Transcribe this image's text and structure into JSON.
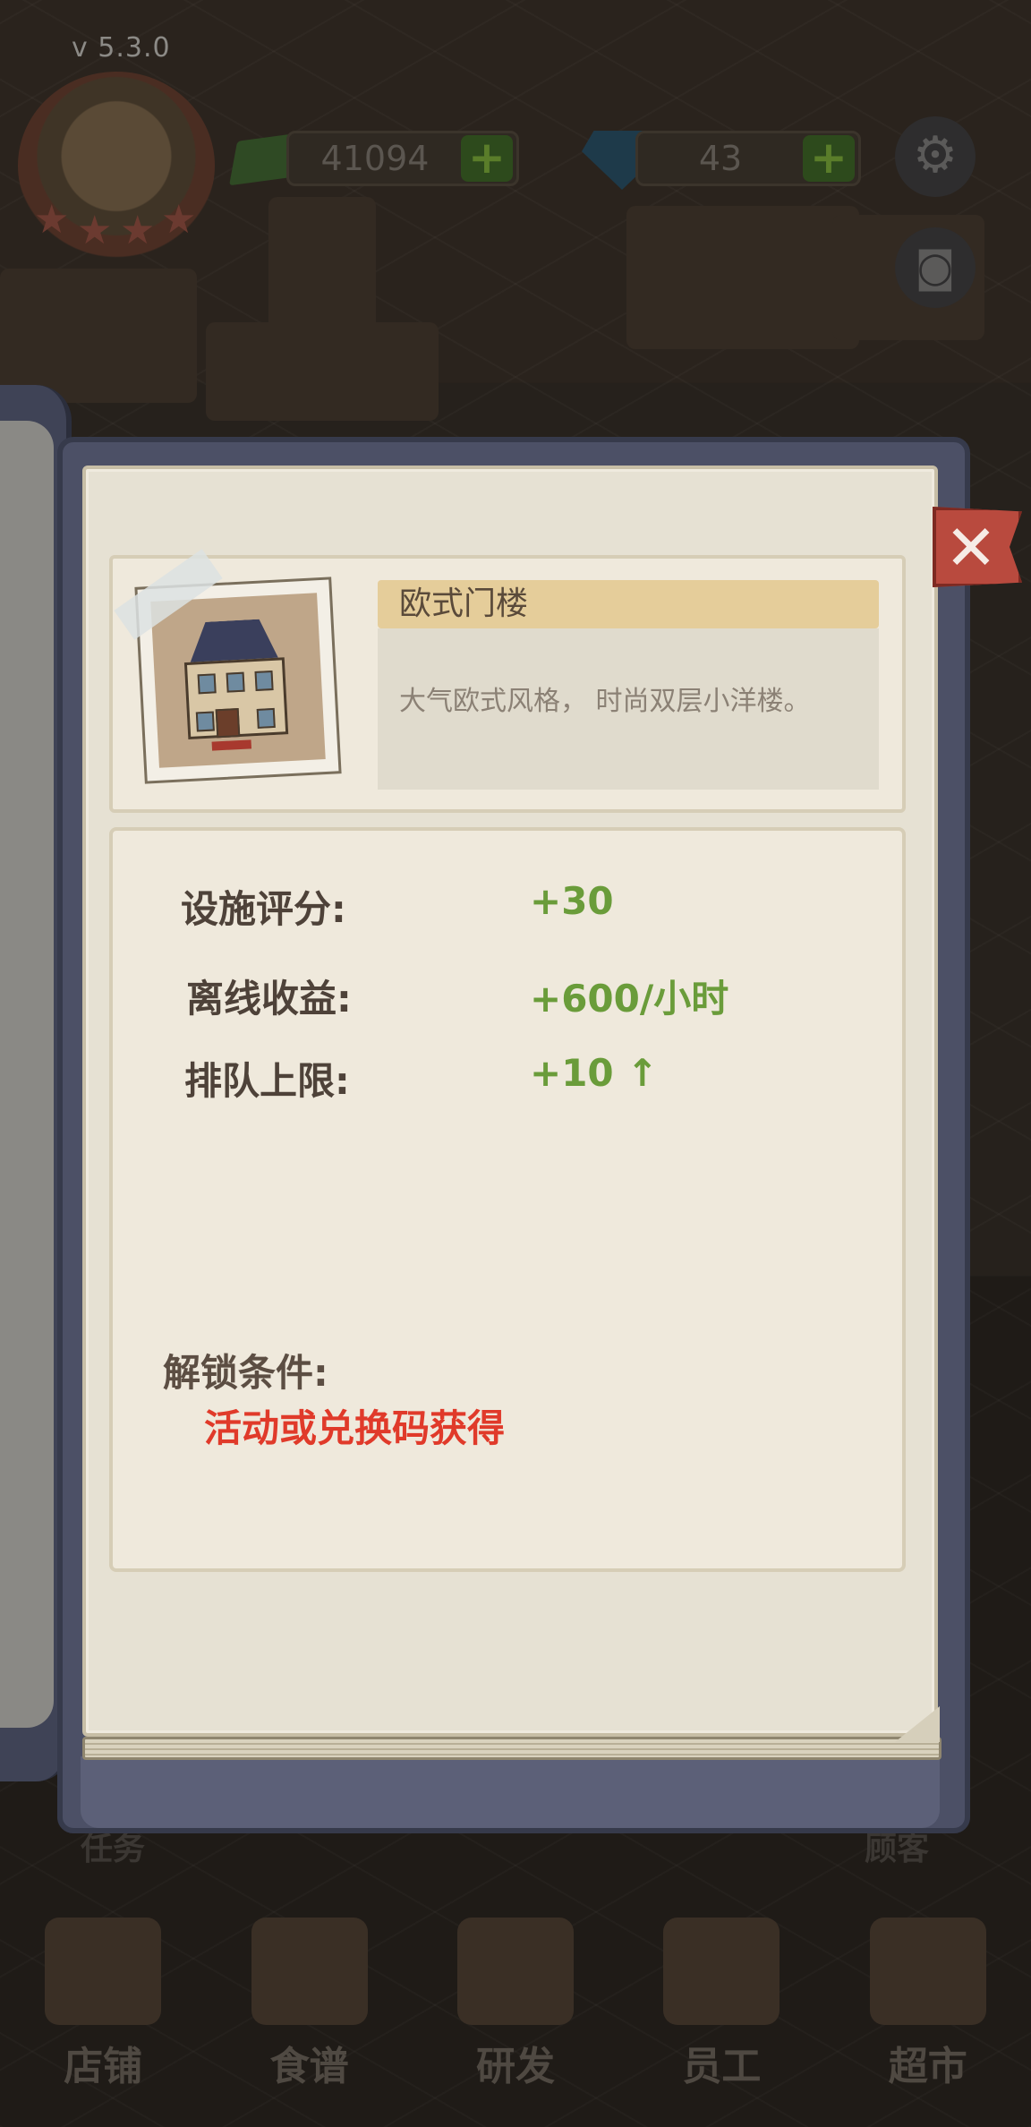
{
  "version": "v  5.3.0",
  "currency": {
    "cash": "41094",
    "gems": "43",
    "plus": "+"
  },
  "item": {
    "name": "欧式门楼",
    "description": "大气欧式风格， 时尚双层小洋楼。"
  },
  "stats": [
    {
      "label": "设施评分:",
      "value": "+30"
    },
    {
      "label": "离线收益:",
      "value": "+600/小时"
    },
    {
      "label": "排队上限:",
      "value": "+10 ↑"
    }
  ],
  "unlock": {
    "label": "解锁条件:",
    "value": "活动或兑换码获得"
  },
  "bottom_nav": [
    "店铺",
    "食谱",
    "研发",
    "员工",
    "超市"
  ],
  "side_labels": {
    "left": "任务",
    "right": "顾客"
  },
  "icons": {
    "close": "close-icon",
    "settings": "gear-icon",
    "camera": "camera-icon"
  },
  "colors": {
    "stat_value": "#6a9c3a",
    "unlock_value": "#e03a2a",
    "title_bar": "#e5cd9a"
  }
}
